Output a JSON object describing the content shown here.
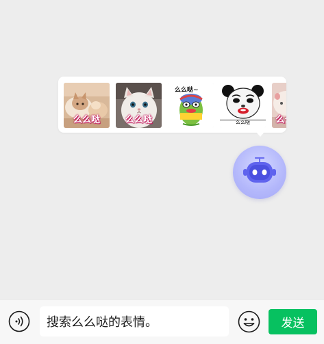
{
  "sticker_popup": {
    "stickers": [
      {
        "icon": "cat-photo-sticker",
        "caption": "么么哒"
      },
      {
        "icon": "white-kitten-sticker",
        "caption": "么么哒"
      },
      {
        "icon": "cartoon-frog-sticker",
        "caption": "么么哒~"
      },
      {
        "icon": "panda-face-meme-sticker",
        "caption": "么么哒"
      },
      {
        "icon": "cat-photo-sticker-partial",
        "caption": "么么"
      }
    ]
  },
  "assistant": {
    "icon": "robot-assistant-icon",
    "accent": "#a9adf8"
  },
  "input_bar": {
    "voice_icon": "voice-icon",
    "input_value": "搜索么么哒的表情。",
    "emoji_icon": "emoji-icon",
    "send_label": "发送",
    "send_color": "#07c160"
  }
}
